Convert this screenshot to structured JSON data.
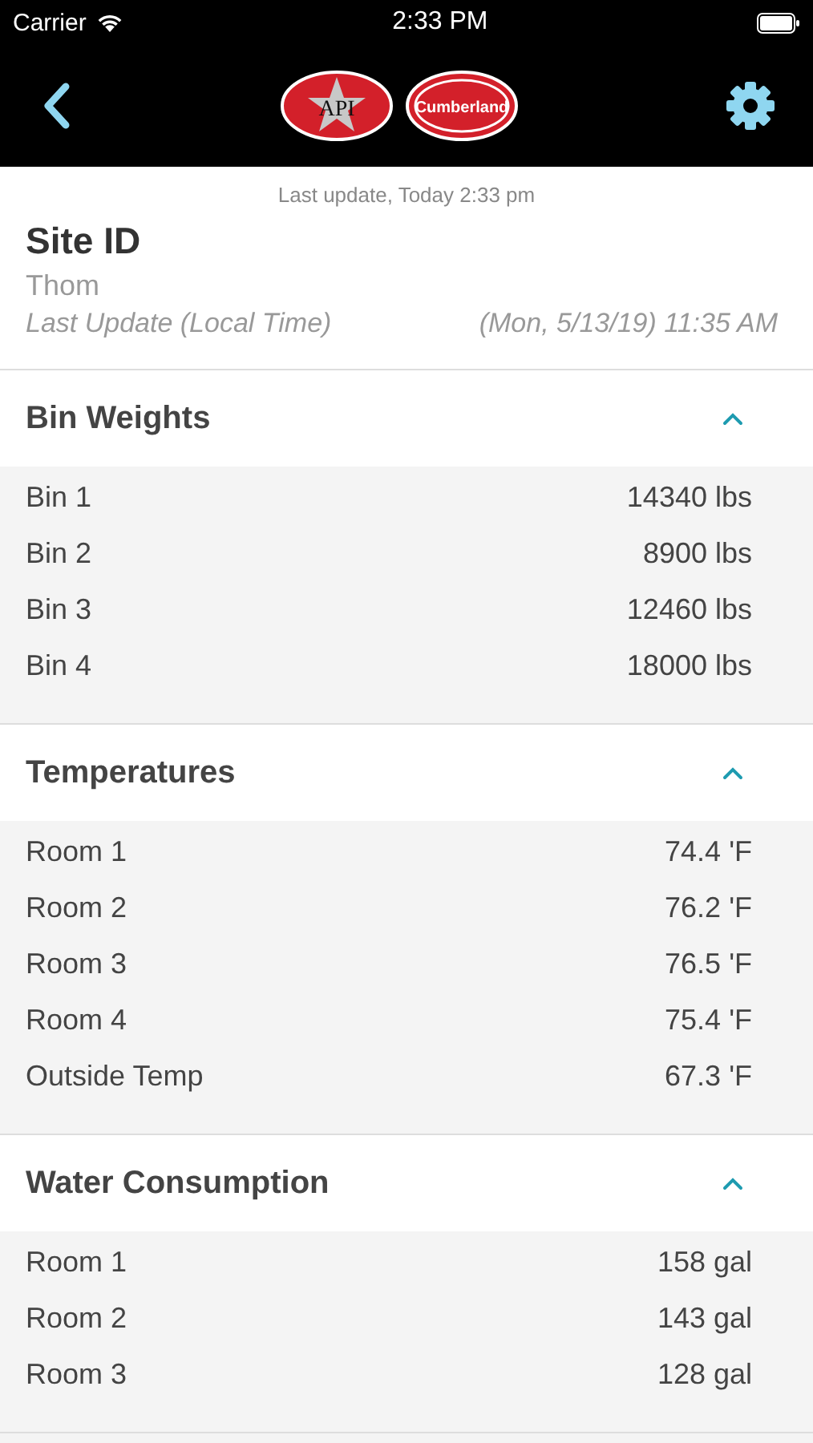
{
  "status_bar": {
    "carrier": "Carrier",
    "time": "2:33 PM"
  },
  "nav": {
    "logos": [
      {
        "kind": "star",
        "text": "API"
      },
      {
        "kind": "oval",
        "text": "Cumberland"
      }
    ]
  },
  "last_refresh": "Last update, Today 2:33 pm",
  "site": {
    "title": "Site ID",
    "name": "Thom",
    "update_label": "Last Update (Local Time)",
    "update_value": "(Mon, 5/13/19) 11:35 AM"
  },
  "sections": [
    {
      "title": "Bin Weights",
      "expanded": true,
      "rows": [
        {
          "label": "Bin 1",
          "value": "14340 lbs"
        },
        {
          "label": "Bin 2",
          "value": "8900 lbs"
        },
        {
          "label": "Bin 3",
          "value": "12460 lbs"
        },
        {
          "label": "Bin 4",
          "value": "18000 lbs"
        }
      ]
    },
    {
      "title": "Temperatures",
      "expanded": true,
      "rows": [
        {
          "label": "Room 1",
          "value": "74.4 'F"
        },
        {
          "label": "Room 2",
          "value": "76.2 'F"
        },
        {
          "label": "Room 3",
          "value": "76.5 'F"
        },
        {
          "label": "Room 4",
          "value": "75.4 'F"
        },
        {
          "label": "Outside Temp",
          "value": "67.3 'F"
        }
      ]
    },
    {
      "title": "Water Consumption",
      "expanded": true,
      "rows": [
        {
          "label": "Room 1",
          "value": "158 gal"
        },
        {
          "label": "Room 2",
          "value": "143 gal"
        },
        {
          "label": "Room 3",
          "value": "128 gal"
        }
      ]
    }
  ]
}
